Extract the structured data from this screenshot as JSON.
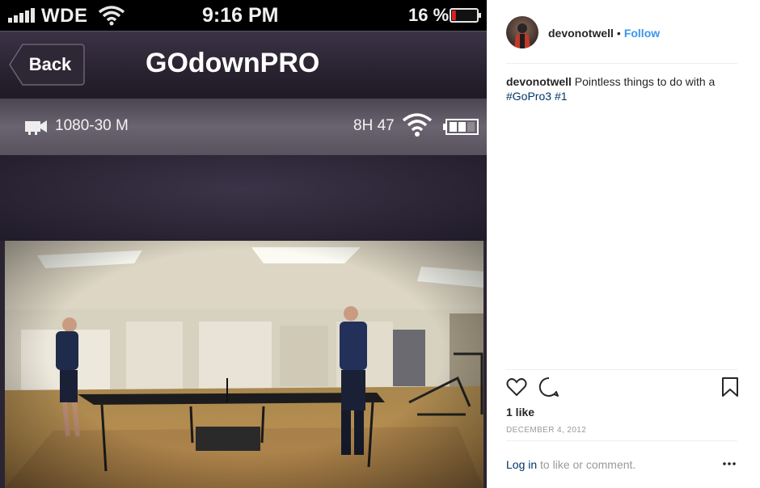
{
  "phone_status": {
    "carrier": "WDE",
    "time": "9:16 PM",
    "battery_percent": "16 %",
    "signal_bars": 5,
    "battery_level": 0.16,
    "battery_color": "#e02020"
  },
  "app_nav": {
    "back_label": "Back",
    "title": "GOdownPRO"
  },
  "camera_status": {
    "video_mode": "1080-30 M",
    "remaining_time": "8H 47",
    "camera_battery_level": 0.66,
    "icons": [
      "video-camera-icon",
      "wifi-icon",
      "battery-icon"
    ]
  },
  "post": {
    "username": "devonotwell",
    "separator": "•",
    "follow_label": "Follow",
    "caption_user": "devonotwell",
    "caption_text": "Pointless things to do with a",
    "hashtags": [
      "#GoPro3",
      "#1"
    ],
    "likes": "1 like",
    "date": "DECEMBER 4, 2012",
    "login_link": "Log in",
    "login_text": "to like or comment.",
    "action_icons": [
      "heart-icon",
      "comment-icon",
      "bookmark-icon",
      "more-options-icon"
    ],
    "link_color": "#3897f0",
    "hashtag_color": "#003569"
  }
}
